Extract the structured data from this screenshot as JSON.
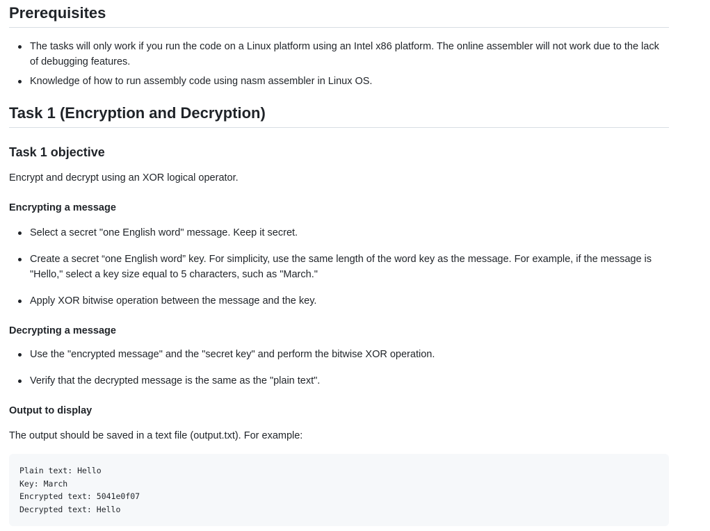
{
  "prereq": {
    "title": "Prerequisites",
    "items": [
      "The tasks will only work if you run the code on a Linux platform using an Intel x86 platform. The online assembler will not work due to the lack of debugging features.",
      "Knowledge of how to run assembly code using nasm assembler in Linux OS."
    ]
  },
  "task1": {
    "title": "Task 1 (Encryption and Decryption)",
    "objective_heading": "Task 1 objective",
    "objective_text": "Encrypt and decrypt using an XOR logical operator.",
    "encrypt": {
      "heading": "Encrypting a message",
      "items": [
        "Select a secret \"one English word\" message. Keep it secret.",
        "Create a secret “one English word” key. For simplicity, use the same length of the word key as the message. For example, if the message is \"Hello,\" select a key size equal to 5 characters, such as \"March.\"",
        "Apply XOR bitwise operation between the message and the key."
      ]
    },
    "decrypt": {
      "heading": "Decrypting a message",
      "items": [
        "Use the \"encrypted message\" and the \"secret key\" and perform the bitwise XOR operation.",
        "Verify that the decrypted message is the same as the \"plain text\"."
      ]
    },
    "output": {
      "heading": "Output to display",
      "text": "The output should be saved in a text file (output.txt). For example:",
      "code": [
        "Plain text: Hello",
        "Key: March",
        "Encrypted text: 5041e0f07",
        "Decrypted text: Hello"
      ]
    }
  }
}
